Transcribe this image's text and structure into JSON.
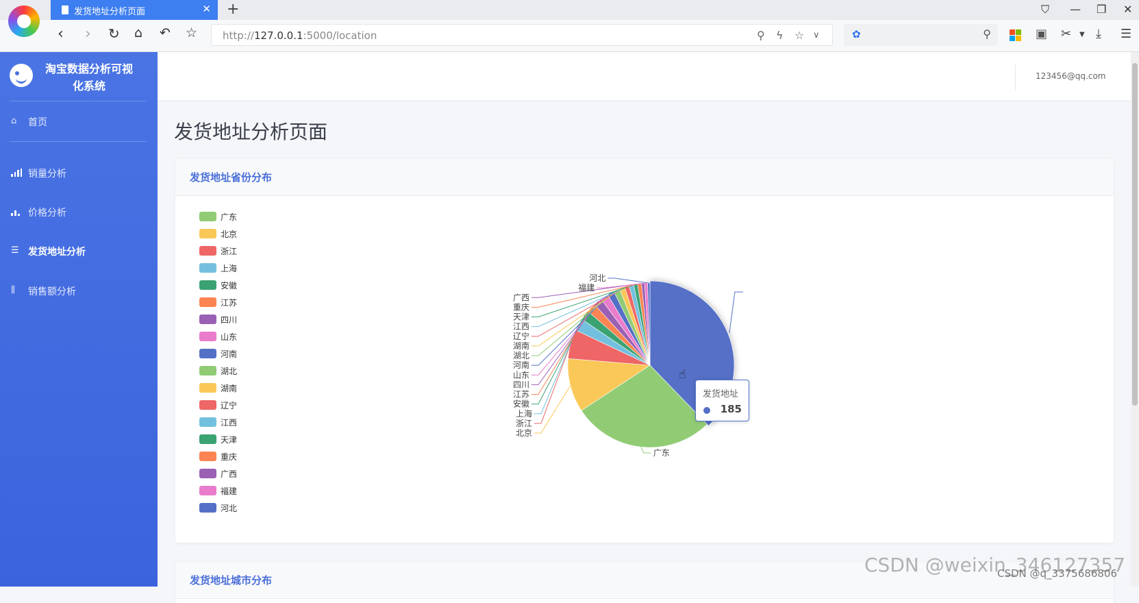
{
  "browser": {
    "tab_title": "发货地址分析页面",
    "url_prefix": "http://",
    "url_host": "127.0.0.1",
    "url_path": ":5000/location"
  },
  "sidebar": {
    "brand": "淘宝数据分析可视化系统",
    "items": [
      {
        "label": "首页",
        "icon": "home-icon"
      },
      {
        "label": "销量分析",
        "icon": "bar-chart-icon"
      },
      {
        "label": "价格分析",
        "icon": "bar-chart-small-icon"
      },
      {
        "label": "发货地址分析",
        "icon": "sliders-icon"
      },
      {
        "label": "销售额分析",
        "icon": "equalizer-icon"
      }
    ]
  },
  "header": {
    "user_email": "123456@qq.com"
  },
  "page": {
    "title": "发货地址分析页面"
  },
  "cards": [
    {
      "title": "发货地址省份分布"
    },
    {
      "title": "发货地址城市分布"
    }
  ],
  "tooltip": {
    "title": "发货地址",
    "value": "185"
  },
  "watermark": {
    "main": "CSDN @weixin_346127357",
    "sub": "CSDN @q_3375686806"
  },
  "colors": {
    "sidebar": "#4a74e4",
    "accent": "#4a6fd9",
    "palette": [
      "#91cc75",
      "#fac858",
      "#ee6666",
      "#73c0de",
      "#3ba272",
      "#fc8452",
      "#9a60b4",
      "#ea7ccc",
      "#5470c6"
    ]
  },
  "chart_data": {
    "type": "pie",
    "series_name": "发货地址",
    "categories": [
      "广东",
      "北京",
      "浙江",
      "上海",
      "安徽",
      "江苏",
      "四川",
      "山东",
      "河南",
      "湖北",
      "湖南",
      "辽宁",
      "江西",
      "天津",
      "重庆",
      "广西",
      "福建",
      "河北"
    ],
    "values": [
      185,
      70,
      38,
      16,
      13,
      12,
      11,
      10,
      9,
      8,
      7,
      6,
      6,
      5,
      5,
      4,
      4,
      3
    ],
    "extra_slice": {
      "value": 250,
      "color": "#5470c6"
    },
    "legend": "left-vertical"
  }
}
